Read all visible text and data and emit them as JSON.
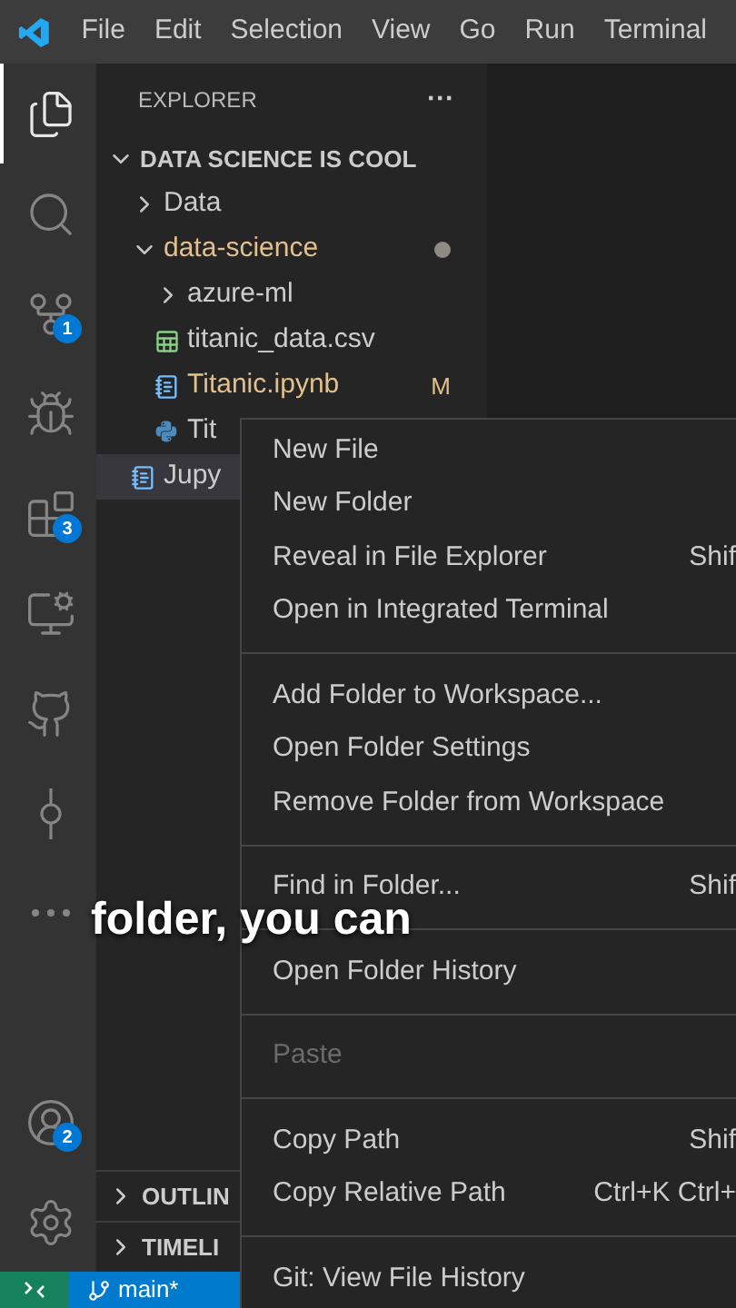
{
  "menu_bar": [
    "File",
    "Edit",
    "Selection",
    "View",
    "Go",
    "Run",
    "Terminal"
  ],
  "activity_bar": [
    {
      "kind": "explorer",
      "selected": true
    },
    {
      "kind": "search",
      "selected": false
    },
    {
      "kind": "source-control",
      "selected": false,
      "badge": "1"
    },
    {
      "kind": "run-debug",
      "selected": false
    },
    {
      "kind": "extensions",
      "selected": false,
      "badge": "3"
    },
    {
      "kind": "remote",
      "selected": false
    },
    {
      "kind": "github",
      "selected": false
    },
    {
      "kind": "git-graph",
      "selected": false
    },
    {
      "kind": "more",
      "selected": false
    }
  ],
  "activity_bar_bottom": [
    {
      "kind": "accounts",
      "selected": false,
      "badge": "2"
    },
    {
      "kind": "settings",
      "selected": false
    }
  ],
  "sidebar": {
    "title": "EXPLORER",
    "more": "···",
    "tree": [
      {
        "label": "DATA SCIENCE IS COOL",
        "kind": "root",
        "expanded": true,
        "selected": false,
        "modified": false,
        "children": [
          {
            "label": "Data",
            "kind": "folder",
            "expanded": false,
            "selected": false,
            "modified": false
          },
          {
            "label": "data-science",
            "kind": "folder",
            "expanded": true,
            "selected": false,
            "modified": true,
            "children": [
              {
                "label": "azure-ml",
                "kind": "folder",
                "expanded": false,
                "selected": false,
                "modified": false
              },
              {
                "label": "titanic_data.csv",
                "kind": "csv",
                "selected": false,
                "modified": false
              },
              {
                "label": "Titanic.ipynb",
                "kind": "notebook",
                "selected": false,
                "modified": true,
                "badge": "M"
              },
              {
                "label": "Tit",
                "kind": "python",
                "selected": false,
                "modified": false
              }
            ]
          },
          {
            "label": "Jupy",
            "kind": "notebook",
            "selected": true,
            "modified": false
          }
        ]
      }
    ],
    "sections": [
      {
        "label": "OUTLIN",
        "expanded": false
      },
      {
        "label": "TIMELI",
        "expanded": false
      }
    ]
  },
  "context_menu": [
    [
      {
        "label": "New File",
        "disabled": false
      },
      {
        "label": "New Folder",
        "disabled": false
      },
      {
        "label": "Reveal in File Explorer",
        "shortcut": "Shif",
        "disabled": false
      },
      {
        "label": "Open in Integrated Terminal",
        "disabled": false
      }
    ],
    [
      {
        "label": "Add Folder to Workspace...",
        "disabled": false
      },
      {
        "label": "Open Folder Settings",
        "disabled": false
      },
      {
        "label": "Remove Folder from Workspace",
        "disabled": false
      }
    ],
    [
      {
        "label": "Find in Folder...",
        "shortcut": "Shif",
        "disabled": false
      }
    ],
    [
      {
        "label": "Open Folder History",
        "disabled": false
      }
    ],
    [
      {
        "label": "Paste",
        "disabled": true
      }
    ],
    [
      {
        "label": "Copy Path",
        "shortcut": "Shif",
        "disabled": false
      },
      {
        "label": "Copy Relative Path",
        "shortcut": "Ctrl+K Ctrl+",
        "disabled": false
      }
    ],
    [
      {
        "label": "Git: View File History",
        "disabled": false
      }
    ]
  ],
  "status_bar": {
    "branch": "main*"
  },
  "caption": "folder, you can"
}
